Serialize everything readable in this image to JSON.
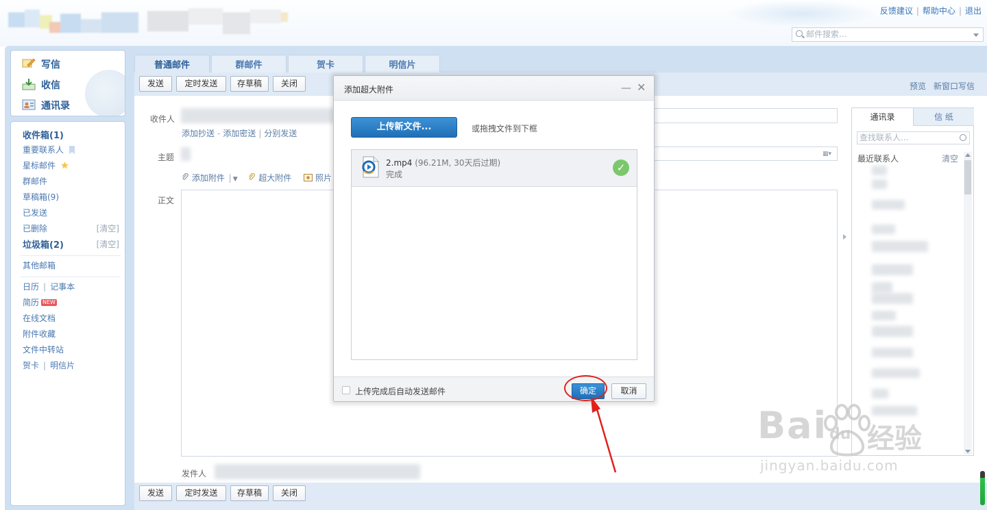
{
  "header": {
    "links": [
      "反馈建议",
      "帮助中心",
      "退出"
    ],
    "search_placeholder": "邮件搜索..."
  },
  "sidebar": {
    "top": [
      {
        "label": "写信",
        "icon": "compose-icon"
      },
      {
        "label": "收信",
        "icon": "inbox-icon"
      },
      {
        "label": "通讯录",
        "icon": "contacts-icon"
      }
    ],
    "folders": [
      {
        "label": "收件箱(1)",
        "bold": true
      },
      {
        "label": "重要联系人"
      },
      {
        "label": "星标邮件"
      },
      {
        "label": "群邮件"
      },
      {
        "label": "草稿箱(9)"
      },
      {
        "label": "已发送"
      },
      {
        "label": "已删除",
        "action": "[清空]"
      },
      {
        "label": "垃圾箱(2)",
        "bold": true,
        "action": "[清空]"
      }
    ],
    "other": "其他邮箱",
    "tools": {
      "calendar": "日历",
      "notes": "记事本",
      "resume": "简历",
      "new_badge": "NEW",
      "docs": "在线文档",
      "attachments": "附件收藏",
      "transfer": "文件中转站",
      "card": "贺卡",
      "postcard": "明信片"
    }
  },
  "tabs": [
    "普通邮件",
    "群邮件",
    "贺卡",
    "明信片"
  ],
  "toolbar": {
    "send": "发送",
    "scheduled": "定时发送",
    "draft": "存草稿",
    "close": "关闭",
    "preview": "预览",
    "new_window": "新窗口写信"
  },
  "compose": {
    "to_label": "收件人",
    "cc_links": [
      "添加抄送",
      "添加密送",
      "分别发送"
    ],
    "subject_label": "主题",
    "attach": "添加附件",
    "big_attach": "超大附件",
    "photo": "照片",
    "body_label": "正文",
    "sender_label": "发件人"
  },
  "contacts": {
    "tab_contacts": "通讯录",
    "tab_paper": "信 纸",
    "search_placeholder": "查找联系人...",
    "recent": "最近联系人",
    "clear": "清空"
  },
  "dialog": {
    "title": "添加超大附件",
    "upload_button": "上传新文件...",
    "hint": "或拖拽文件到下框",
    "file": {
      "name": "2.mp4",
      "meta": "(96.21M, 30天后过期)",
      "status": "完成"
    },
    "auto_send": "上传完成后自动发送邮件",
    "ok": "确定",
    "cancel": "取消"
  },
  "watermark": {
    "brand": "Bai",
    "brand2": "du",
    "jingyan": "经验",
    "url": "jingyan.baidu.com"
  },
  "colors": {
    "accent_blue": "#1f6fb7",
    "sidebar_link": "#4a78b0",
    "success_green": "#7bc86c",
    "annotation_red": "#e0201b"
  }
}
